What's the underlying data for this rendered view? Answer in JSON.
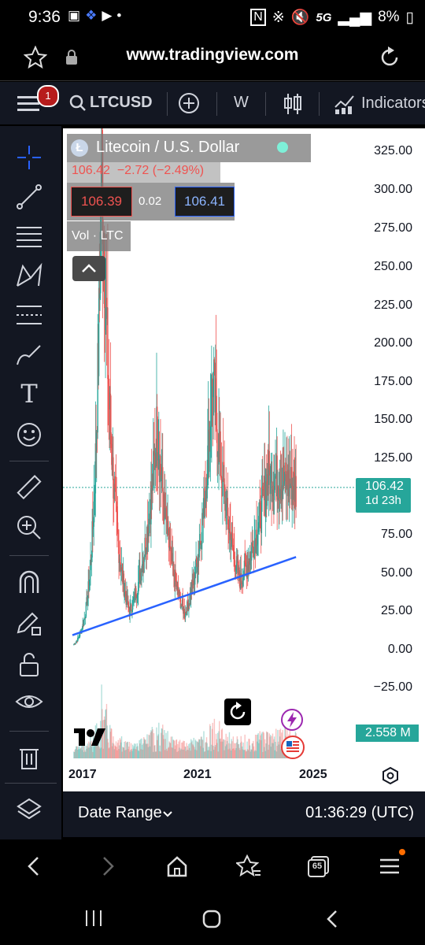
{
  "status": {
    "time": "9:36",
    "network": "5G",
    "battery": "8%"
  },
  "browser": {
    "url": "www.tradingview.com",
    "tabs_count": "65"
  },
  "toolbar": {
    "notification_count": "1",
    "symbol": "LTCUSD",
    "interval": "W",
    "indicators_label": "Indicators"
  },
  "legend": {
    "title": "Litecoin / U.S. Dollar",
    "quote": "106.42  −2.72 (−2.49%)",
    "bid": "106.39",
    "spread": "0.02",
    "ask": "106.41",
    "volume_label": "Vol · LTC"
  },
  "price_axis": [
    "325.00",
    "300.00",
    "275.00",
    "250.00",
    "225.00",
    "200.00",
    "175.00",
    "150.00",
    "125.00",
    "106.42",
    "75.00",
    "50.00",
    "25.00",
    "0.00",
    "−25.00"
  ],
  "current_price": {
    "value": "106.42",
    "countdown": "1d 23h"
  },
  "volume": {
    "value": "2.558 M"
  },
  "time_axis": [
    "2017",
    "2021",
    "2025"
  ],
  "bottom": {
    "date_range_label": "Date Range",
    "clock": "01:36:29 (UTC)"
  },
  "chart_data": {
    "type": "candlestick",
    "x": [
      "2017",
      "2018",
      "2019",
      "2020",
      "2021",
      "2022",
      "2023",
      "2024"
    ],
    "values": [
      4,
      330,
      25,
      148,
      24,
      180,
      45,
      115,
      106.42
    ],
    "trendline": {
      "from": [
        2017,
        10
      ],
      "to": [
        2024.7,
        61
      ]
    },
    "ylim": [
      -25,
      340
    ],
    "colors": {
      "up": "#26a69a",
      "down": "#ef5350",
      "trendline": "#2962ff"
    }
  }
}
